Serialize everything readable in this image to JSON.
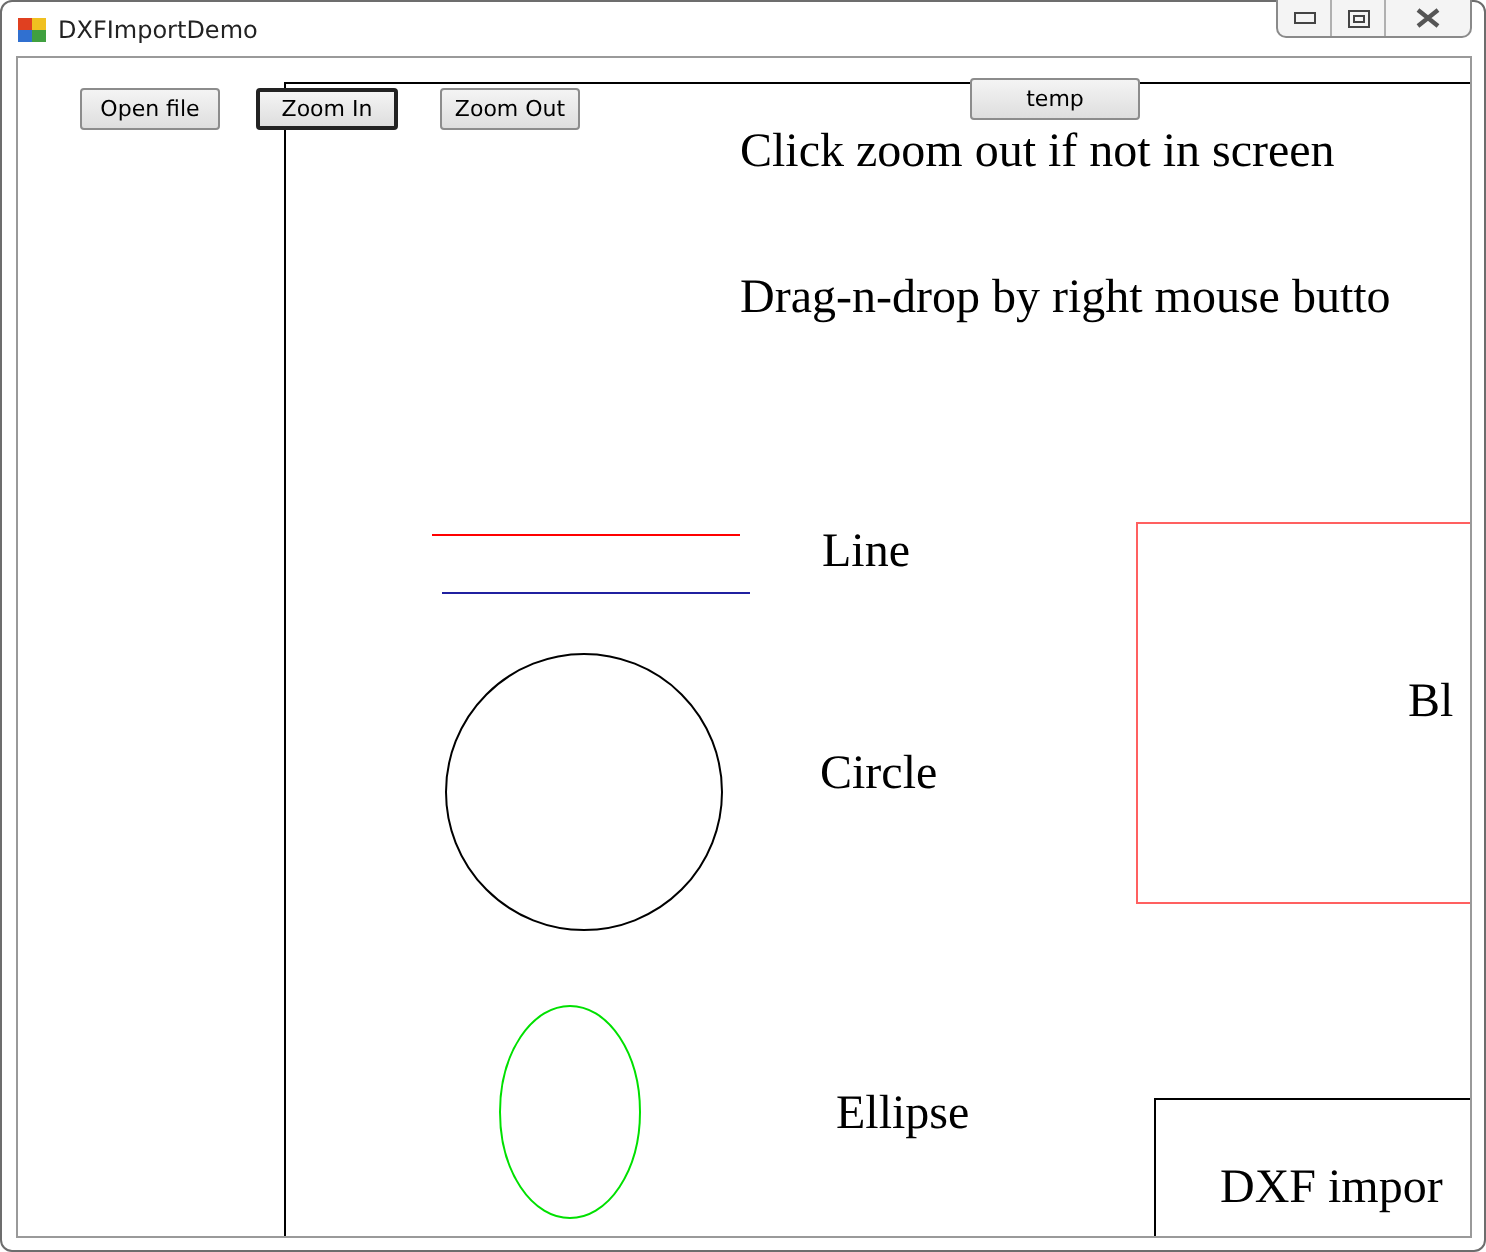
{
  "window": {
    "title": "DXFImportDemo"
  },
  "buttons": [
    {
      "label": "Open file",
      "focused": false
    },
    {
      "label": "Zoom In",
      "focused": true
    },
    {
      "label": "Zoom Out",
      "focused": false
    },
    {
      "label": "temp",
      "focused": false
    }
  ],
  "canvas": {
    "notes": [
      "Click zoom out if not in screen",
      "Drag-n-drop by right mouse butto"
    ],
    "shapes": [
      {
        "kind": "lines",
        "label": "Line"
      },
      {
        "kind": "circle",
        "label": "Circle"
      },
      {
        "kind": "ellipse",
        "label": "Ellipse"
      },
      {
        "kind": "block",
        "label": "Bl"
      },
      {
        "kind": "box",
        "label": "DXF impor"
      }
    ]
  }
}
